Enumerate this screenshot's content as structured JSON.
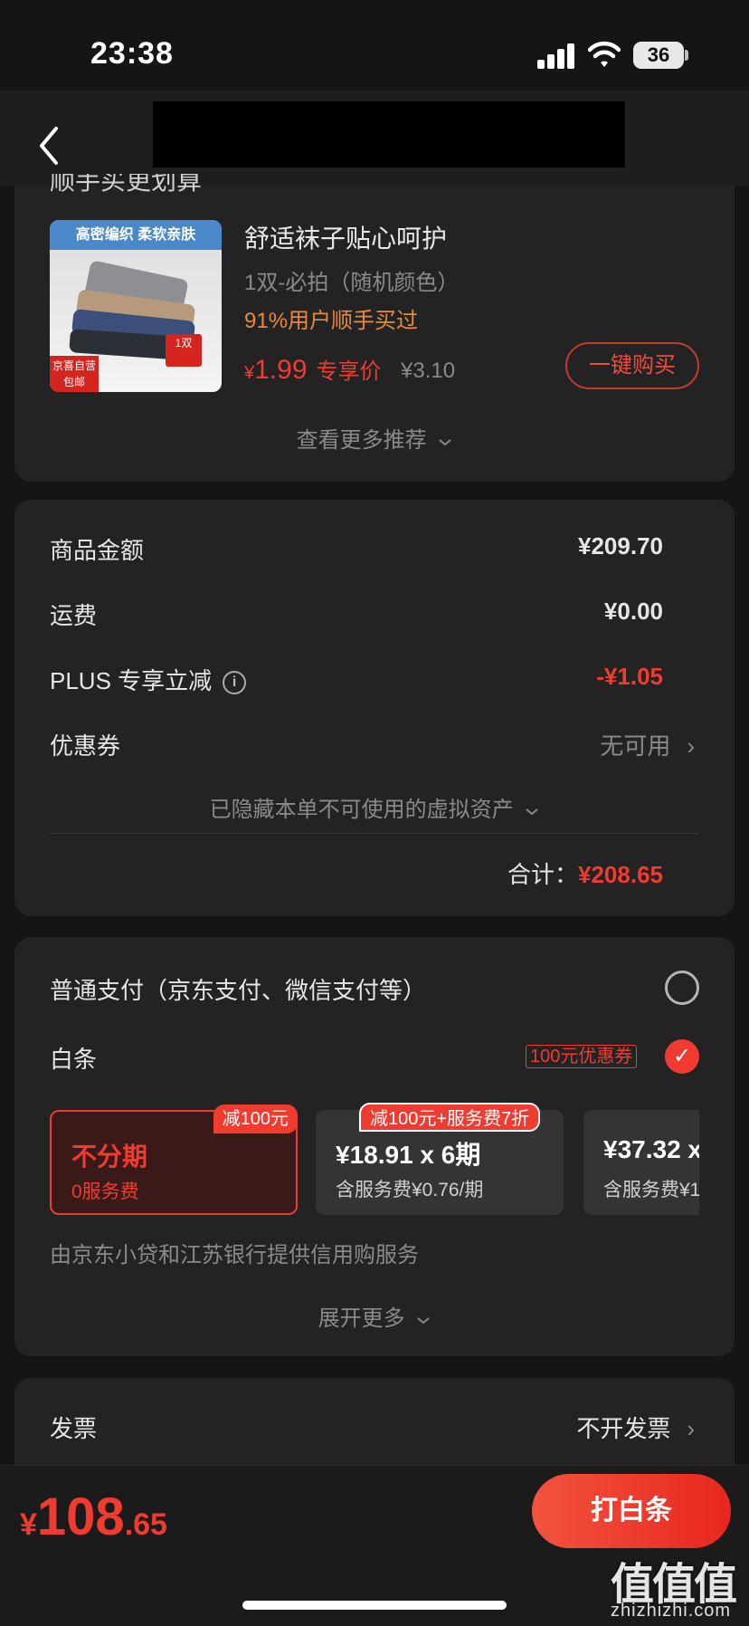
{
  "status_bar": {
    "time": "23:38",
    "battery": "36"
  },
  "recommend": {
    "partial_title": "顺手买更划算",
    "product": {
      "image_banner": "高密编织 柔软亲肤",
      "image_badge_left": "京喜自营\n包邮",
      "image_badge_right": "1双",
      "name": "舒适袜子贴心呵护",
      "spec": "1双-必拍（随机颜色）",
      "bought": "91%用户顺手买过",
      "price_symbol": "¥",
      "price": "1.99",
      "price_label": "专享价",
      "old_price": "¥3.10",
      "buy_label": "一键购买"
    },
    "more_label": "查看更多推荐"
  },
  "summary": {
    "goods_label": "商品金额",
    "goods_value": "¥209.70",
    "shipping_label": "运费",
    "shipping_value": "¥0.00",
    "plus_label": "PLUS 专享立减",
    "plus_value": "-¥1.05",
    "coupon_label": "优惠券",
    "coupon_value": "无可用",
    "hidden_assets": "已隐藏本单不可使用的虚拟资产",
    "total_label": "合计：",
    "total_value": "¥208.65"
  },
  "payment": {
    "normal_label": "普通支付（京东支付、微信支付等）",
    "baitiao_label": "白条",
    "coupon_tag": "100元优惠券",
    "installments": [
      {
        "tag": "减100元",
        "title": "不分期",
        "sub": "0服务费"
      },
      {
        "tag": "减100元+服务费7折",
        "title": "¥18.91 x 6期",
        "sub": "含服务费¥0.76/期"
      },
      {
        "title": "¥37.32 x",
        "sub": "含服务费¥1"
      }
    ],
    "provider": "由京东小贷和江苏银行提供信用购服务",
    "expand": "展开更多"
  },
  "invoice": {
    "label": "发票",
    "value": "不开发票"
  },
  "bottom": {
    "symbol": "¥",
    "int": "108",
    "dec": ".65",
    "pay_label": "打白条"
  },
  "watermark": {
    "main": "值值值",
    "url": "zhizhizhi.com"
  },
  "colors": {
    "accent": "#ef3b30",
    "bg": "#151515",
    "card": "#232323"
  }
}
